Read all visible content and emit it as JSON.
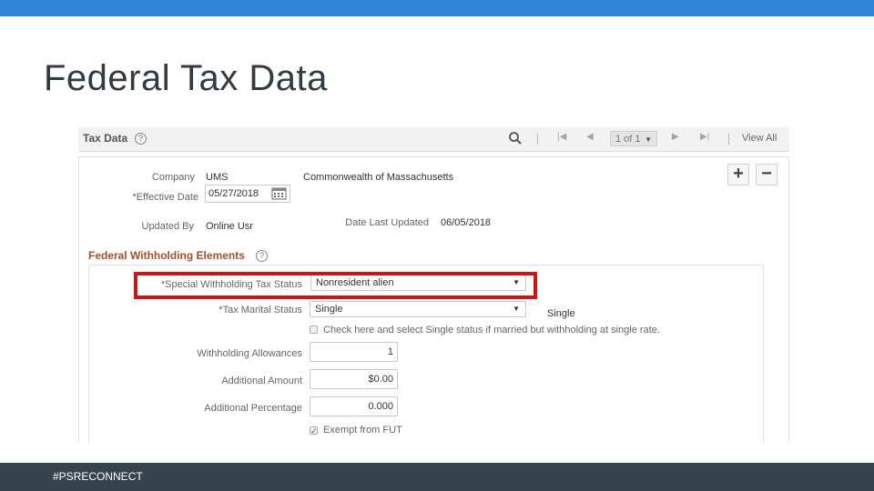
{
  "slide": {
    "title": "Federal Tax Data",
    "footer": "#PSRECONNECT",
    "top_bar_color": "#2e84d6",
    "footer_color": "#37444e"
  },
  "header": {
    "title": "Tax Data",
    "help_glyph": "?",
    "search_icon": "search-icon",
    "first_glyph": "|◀",
    "prev_glyph": "◀",
    "pager_value": "1 of 1",
    "pager_caret": "▼",
    "next_glyph": "▶",
    "last_glyph": "▶|",
    "view_all": "View All"
  },
  "record": {
    "company_label": "Company",
    "company_code": "UMS",
    "company_name": "Commonwealth of Massachusetts",
    "effective_date_label": "*Effective Date",
    "effective_date": "05/27/2018",
    "calendar_icon": "calendar-icon",
    "updated_by_label": "Updated By",
    "updated_by": "Online Usr",
    "date_last_updated_label": "Date Last Updated",
    "date_last_updated": "06/05/2018",
    "add_glyph": "+",
    "remove_glyph": "−"
  },
  "federal": {
    "section_title": "Federal Withholding Elements",
    "special_status_label": "*Special Withholding Tax Status",
    "special_status_value": "Nonresident alien",
    "marital_status_label": "*Tax Marital Status",
    "marital_status_value": "Single",
    "marital_status_display": "Single",
    "single_rate_checkbox_label": "Check here and select Single status if married but withholding at single rate.",
    "single_rate_checked": false,
    "withholding_allowances_label": "Withholding Allowances",
    "withholding_allowances": "1",
    "additional_amount_label": "Additional Amount",
    "additional_amount": "$0.00",
    "additional_percentage_label": "Additional Percentage",
    "additional_percentage": "0.000",
    "exempt_futa_label": "Exempt from FUT",
    "exempt_futa_checked": true,
    "select_arrow": "▼",
    "check_glyph": "✓",
    "highlight_color": "#cc1616"
  }
}
